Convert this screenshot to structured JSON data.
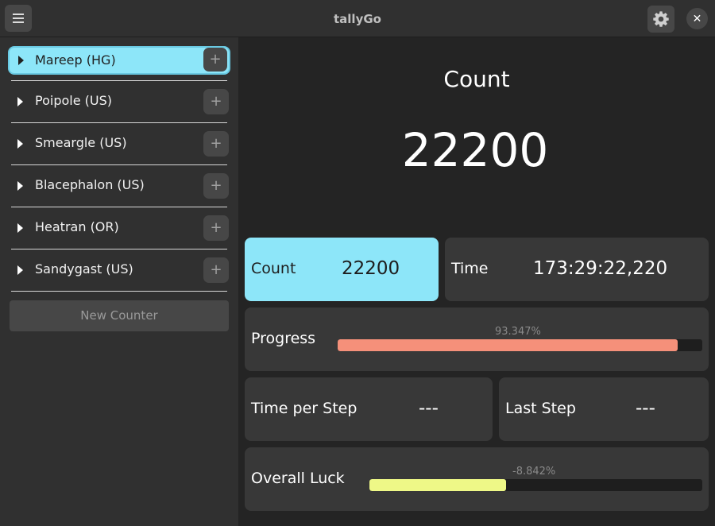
{
  "header": {
    "title": "tallyGo",
    "menu_icon": "hamburger-menu-icon",
    "settings_icon": "gear-icon",
    "close_icon": "close-icon",
    "close_glyph": "✕"
  },
  "sidebar": {
    "items": [
      {
        "label": "Mareep (HG)",
        "active": true
      },
      {
        "label": "Poipole (US)",
        "active": false
      },
      {
        "label": "Smeargle (US)",
        "active": false
      },
      {
        "label": "Blacephalon (US)",
        "active": false
      },
      {
        "label": "Heatran (OR)",
        "active": false
      },
      {
        "label": "Sandygast (US)",
        "active": false
      }
    ],
    "plus_glyph": "+",
    "new_counter_label": "New Counter"
  },
  "main": {
    "title": "Count",
    "count_value": "22200",
    "cards": {
      "count": {
        "label": "Count",
        "value": "22200"
      },
      "time": {
        "label": "Time",
        "value": "173:29:22,220"
      },
      "progress": {
        "label": "Progress",
        "percent_text": "93.347%",
        "fraction": 0.93347,
        "color": "#f5907a"
      },
      "time_per_step": {
        "label": "Time per Step",
        "value": "---"
      },
      "last_step": {
        "label": "Last Step",
        "value": "---"
      },
      "overall_luck": {
        "label": "Overall Luck",
        "percent_text": "-8.842%",
        "fraction": 0.41,
        "color": "#eef887"
      }
    }
  },
  "colors": {
    "accent": "#8de6f9",
    "sidebar_bg": "#303030",
    "main_bg": "#242424",
    "card_bg": "#383838"
  }
}
